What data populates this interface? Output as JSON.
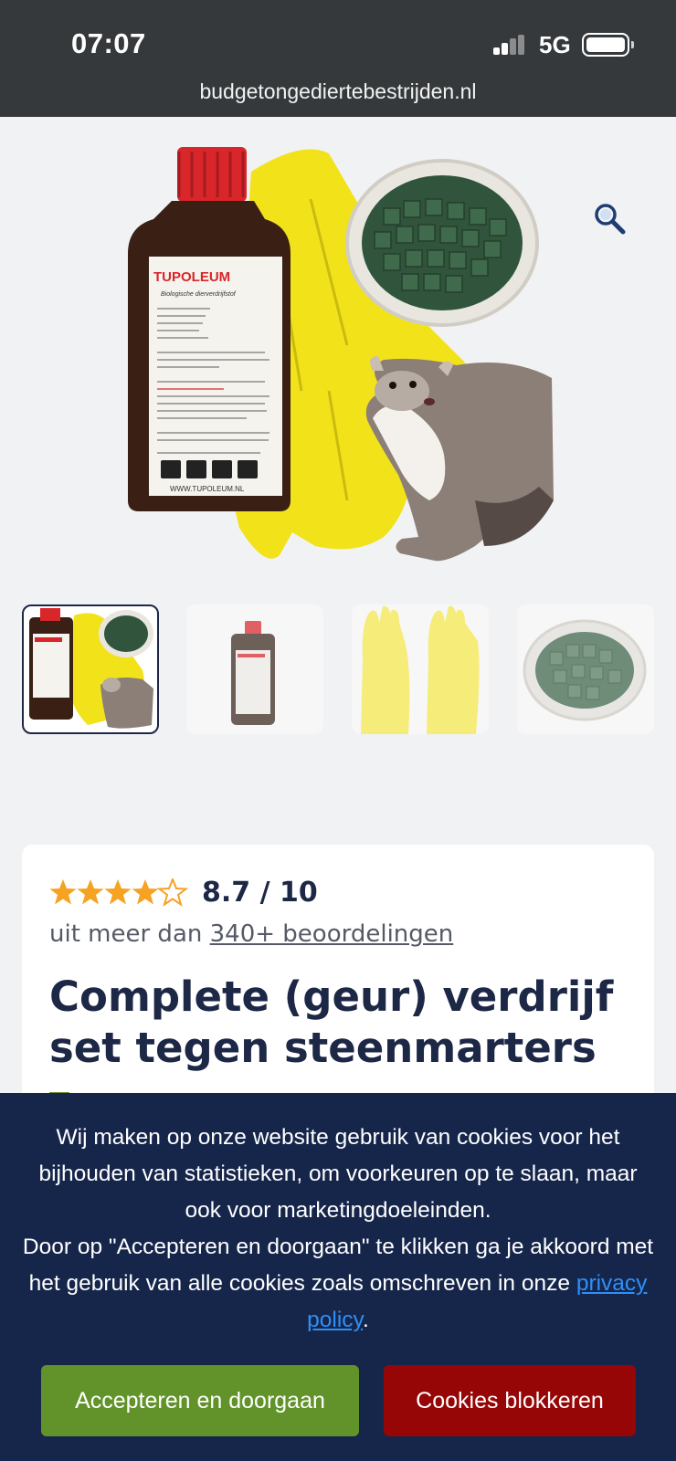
{
  "status_bar": {
    "time": "07:07",
    "network": "5G"
  },
  "browser": {
    "url": "budgetongediertebestrijden.nl"
  },
  "product": {
    "rating": "8.7 / 10",
    "stars": 4.5,
    "reviews_prefix": "uit meer dan ",
    "reviews_link": "340+ beoordelingen",
    "title": "Complete (geur) verdrijf set tegen steenmarters",
    "bottle_brand": "TUPOLEUM",
    "bottle_subtitle": "Biologische dierverdrijfstof",
    "bottle_url": "WWW.TUPOLEUM.NL"
  },
  "cookie_banner": {
    "text_line1": "Wij maken op onze website gebruik van cookies voor het bijhouden van statistieken, om voorkeuren op te slaan, maar ook voor marketingdoeleinden.",
    "text_line2_prefix": "Door op \"Accepteren en doorgaan\" te klikken ga je akkoord met het gebruik van alle cookies zoals omschreven in onze ",
    "privacy_link": "privacy policy",
    "text_line2_suffix": ".",
    "accept_label": "Accepteren en doorgaan",
    "block_label": "Cookies blokkeren"
  },
  "colors": {
    "header_bg": "#36393b",
    "title_navy": "#1d2746",
    "star_orange": "#f6a223",
    "banner_bg": "#16264b",
    "accept_green": "#62932a",
    "block_red": "#960606",
    "link_blue": "#2f8ff7"
  }
}
